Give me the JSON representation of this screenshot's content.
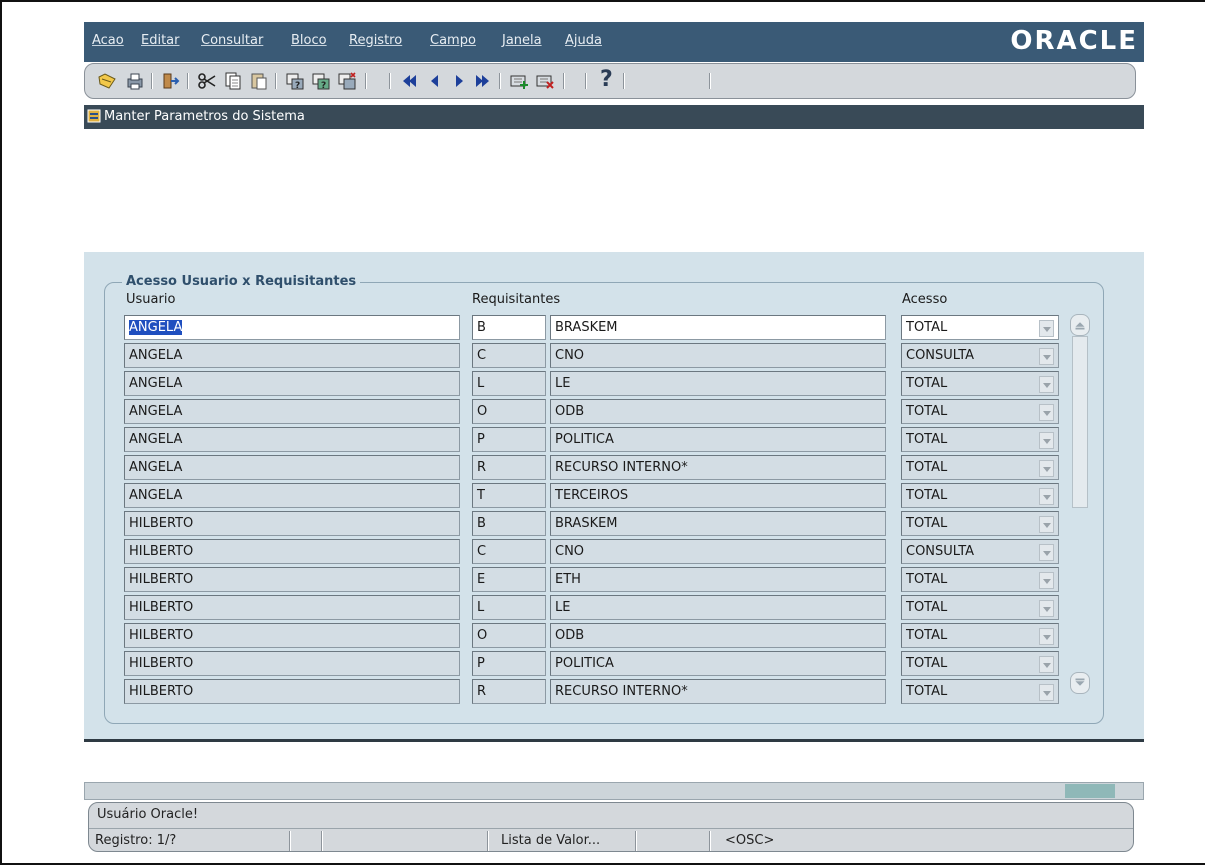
{
  "menu": {
    "items": [
      "Acao",
      "Editar",
      "Consultar",
      "Bloco",
      "Registro",
      "Campo",
      "Janela",
      "Ajuda"
    ],
    "logo": "ORACLE"
  },
  "toolbar": {
    "icons": [
      "save-icon",
      "print-icon",
      "exit-icon",
      "cut-icon",
      "copy-icon",
      "paste-icon",
      "enter-query-icon",
      "execute-query-icon",
      "cancel-query-icon",
      "first-record-icon",
      "previous-record-icon",
      "next-record-icon",
      "last-record-icon",
      "insert-record-icon",
      "delete-record-icon",
      "help-icon"
    ],
    "help_label": "?"
  },
  "window": {
    "title": "Manter Parametros do Sistema"
  },
  "block": {
    "title": "Acesso Usuario x Requisitantes",
    "headers": {
      "usuario": "Usuario",
      "requisitantes": "Requisitantes",
      "acesso": "Acesso"
    },
    "rows": [
      {
        "usuario": "ANGELA",
        "codigo": "B",
        "requisitante": "BRASKEM",
        "acesso": "TOTAL"
      },
      {
        "usuario": "ANGELA",
        "codigo": "C",
        "requisitante": "CNO",
        "acesso": "CONSULTA"
      },
      {
        "usuario": "ANGELA",
        "codigo": "L",
        "requisitante": "LE",
        "acesso": "TOTAL"
      },
      {
        "usuario": "ANGELA",
        "codigo": "O",
        "requisitante": "ODB",
        "acesso": "TOTAL"
      },
      {
        "usuario": "ANGELA",
        "codigo": "P",
        "requisitante": "POLITICA",
        "acesso": "TOTAL"
      },
      {
        "usuario": "ANGELA",
        "codigo": "R",
        "requisitante": "RECURSO INTERNO*",
        "acesso": "TOTAL"
      },
      {
        "usuario": "ANGELA",
        "codigo": "T",
        "requisitante": "TERCEIROS",
        "acesso": "TOTAL"
      },
      {
        "usuario": "HILBERTO",
        "codigo": "B",
        "requisitante": "BRASKEM",
        "acesso": "TOTAL"
      },
      {
        "usuario": "HILBERTO",
        "codigo": "C",
        "requisitante": "CNO",
        "acesso": "CONSULTA"
      },
      {
        "usuario": "HILBERTO",
        "codigo": "E",
        "requisitante": "ETH",
        "acesso": "TOTAL"
      },
      {
        "usuario": "HILBERTO",
        "codigo": "L",
        "requisitante": "LE",
        "acesso": "TOTAL"
      },
      {
        "usuario": "HILBERTO",
        "codigo": "O",
        "requisitante": "ODB",
        "acesso": "TOTAL"
      },
      {
        "usuario": "HILBERTO",
        "codigo": "P",
        "requisitante": "POLITICA",
        "acesso": "TOTAL"
      },
      {
        "usuario": "HILBERTO",
        "codigo": "R",
        "requisitante": "RECURSO INTERNO*",
        "acesso": "TOTAL"
      }
    ]
  },
  "status": {
    "message": "Usuário Oracle!",
    "record": "Registro: 1/?",
    "lov": "Lista de Valor...",
    "mode": "<OSC>"
  },
  "colors": {
    "menubar": "#3a5a76",
    "title_bar": "#394a57",
    "canvas": "#d3e2ea",
    "selection": "#1f4fbf"
  }
}
